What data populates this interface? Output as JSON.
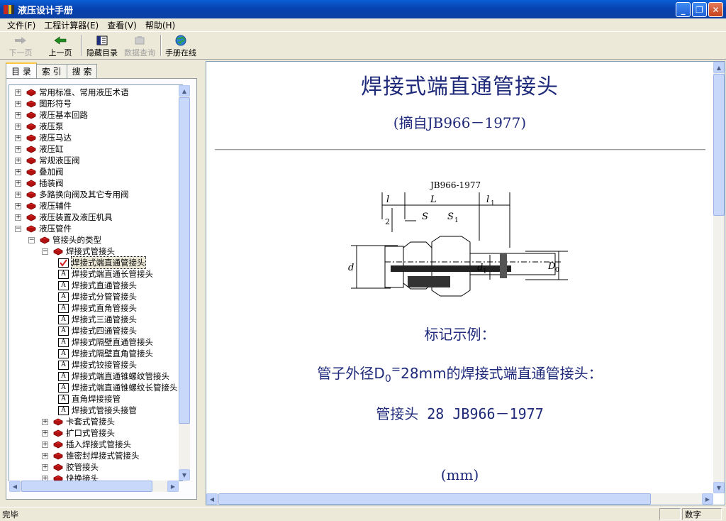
{
  "window": {
    "title": "液压设计手册"
  },
  "menu": [
    "文件(F)",
    "工程计算器(E)",
    "查看(V)",
    "帮助(H)"
  ],
  "toolbar": {
    "next": "下一页",
    "prev": "上一页",
    "hide_toc": "隐藏目录",
    "data_query": "数据查询",
    "online": "手册在线"
  },
  "tabs": [
    "目 录",
    "索 引",
    "搜 索"
  ],
  "tree": [
    {
      "label": "常用标准、常用液压术语",
      "level": 0,
      "type": "book",
      "exp": "+"
    },
    {
      "label": "图形符号",
      "level": 0,
      "type": "book",
      "exp": "+"
    },
    {
      "label": "液压基本回路",
      "level": 0,
      "type": "book",
      "exp": "+"
    },
    {
      "label": "液压泵",
      "level": 0,
      "type": "book",
      "exp": "+"
    },
    {
      "label": "液压马达",
      "level": 0,
      "type": "book",
      "exp": "+"
    },
    {
      "label": "液压缸",
      "level": 0,
      "type": "book",
      "exp": "+"
    },
    {
      "label": "常规液压阀",
      "level": 0,
      "type": "book",
      "exp": "+"
    },
    {
      "label": "叠加阀",
      "level": 0,
      "type": "book",
      "exp": "+"
    },
    {
      "label": "插装阀",
      "level": 0,
      "type": "book",
      "exp": "+"
    },
    {
      "label": "多路换向阀及其它专用阀",
      "level": 0,
      "type": "book",
      "exp": "+"
    },
    {
      "label": "液压辅件",
      "level": 0,
      "type": "book",
      "exp": "+"
    },
    {
      "label": "液压装置及液压机具",
      "level": 0,
      "type": "book",
      "exp": "+"
    },
    {
      "label": "液压管件",
      "level": 0,
      "type": "book",
      "exp": "−"
    },
    {
      "label": "管接头的类型",
      "level": 1,
      "type": "book",
      "exp": "−"
    },
    {
      "label": "焊接式管接头",
      "level": 2,
      "type": "book",
      "exp": "−"
    },
    {
      "label": "焊接式端直通管接头",
      "level": 3,
      "type": "page",
      "sel": true
    },
    {
      "label": "焊接式端直通长管接头",
      "level": 3,
      "type": "page"
    },
    {
      "label": "焊接式直通管接头",
      "level": 3,
      "type": "page"
    },
    {
      "label": "焊接式分管管接头",
      "level": 3,
      "type": "page"
    },
    {
      "label": "焊接式直角管接头",
      "level": 3,
      "type": "page"
    },
    {
      "label": "焊接式三通管接头",
      "level": 3,
      "type": "page"
    },
    {
      "label": "焊接式四通管接头",
      "level": 3,
      "type": "page"
    },
    {
      "label": "焊接式隔壁直通管接头",
      "level": 3,
      "type": "page"
    },
    {
      "label": "焊接式隔壁直角管接头",
      "level": 3,
      "type": "page"
    },
    {
      "label": "焊接式铰接管接头",
      "level": 3,
      "type": "page"
    },
    {
      "label": "焊接式端直通锥螺纹管接头",
      "level": 3,
      "type": "page"
    },
    {
      "label": "焊接式端直通锥螺纹长管接头",
      "level": 3,
      "type": "page"
    },
    {
      "label": "直角焊接接管",
      "level": 3,
      "type": "page"
    },
    {
      "label": "焊接式管接头接管",
      "level": 3,
      "type": "page"
    },
    {
      "label": "卡套式管接头",
      "level": 2,
      "type": "book",
      "exp": "+"
    },
    {
      "label": "扩口式管接头",
      "level": 2,
      "type": "book",
      "exp": "+"
    },
    {
      "label": "插入焊接式管接头",
      "level": 2,
      "type": "book",
      "exp": "+"
    },
    {
      "label": "锥密封焊接式管接头",
      "level": 2,
      "type": "book",
      "exp": "+"
    },
    {
      "label": "胶管接头",
      "level": 2,
      "type": "book",
      "exp": "+"
    },
    {
      "label": "快换接头",
      "level": 2,
      "type": "book",
      "exp": "+"
    }
  ],
  "content": {
    "title": "焊接式端直通管接头",
    "subtitle": "(摘自JB966－1977)",
    "diagram": {
      "label": "JB966-1977",
      "dims": [
        "l",
        "L",
        "l",
        "1",
        "2",
        "S",
        "S",
        "1",
        "d",
        "d",
        "1",
        "D",
        "0"
      ]
    },
    "marking_heading": "标记示例：",
    "example_pre": "管子外径D",
    "example_sub": "0",
    "example_eq": "=",
    "example_post": "28mm的焊接式端直通管接头：",
    "example_mark": "管接头 28 JB966－1977",
    "unit": "(mm)"
  },
  "status": {
    "text": "完毕",
    "mode": "数字"
  }
}
